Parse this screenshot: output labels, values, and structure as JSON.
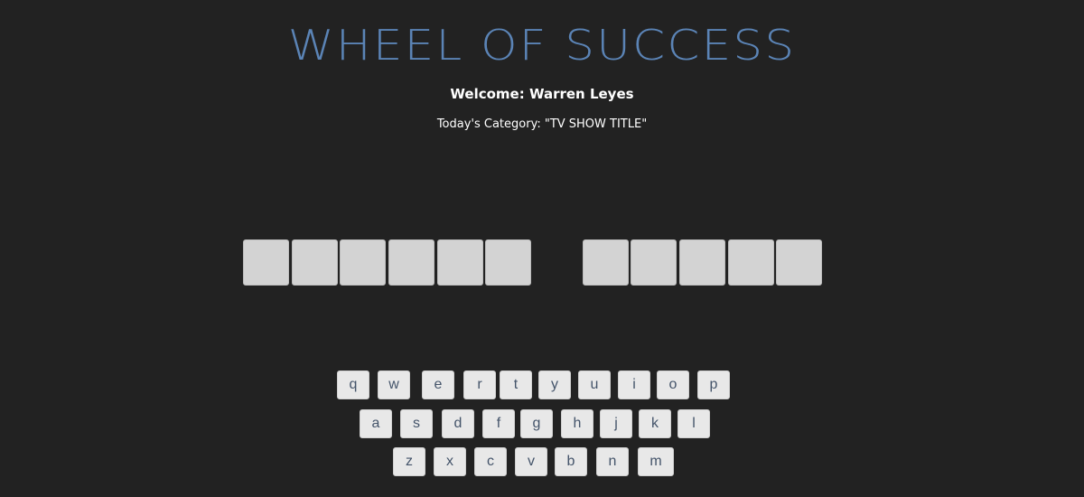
{
  "header": {
    "title": "WHEEL OF SUCCESS",
    "welcome": "Welcome: Warren Leyes",
    "category": "Today's Category: \"TV SHOW TITLE\""
  },
  "board": {
    "words": [
      6,
      5
    ],
    "tile_color": "#d3d3d3"
  },
  "keyboard": {
    "row1": [
      "q",
      "w",
      "e",
      "r",
      "t",
      "y",
      "u",
      "i",
      "o",
      "p"
    ],
    "row2": [
      "a",
      "s",
      "d",
      "f",
      "g",
      "h",
      "j",
      "k",
      "l"
    ],
    "row3": [
      "z",
      "x",
      "c",
      "v",
      "b",
      "n",
      "m"
    ]
  },
  "colors": {
    "background": "#222222",
    "title": "#5b84b6",
    "key_bg": "#e8e8e8",
    "key_text": "#44546a"
  }
}
